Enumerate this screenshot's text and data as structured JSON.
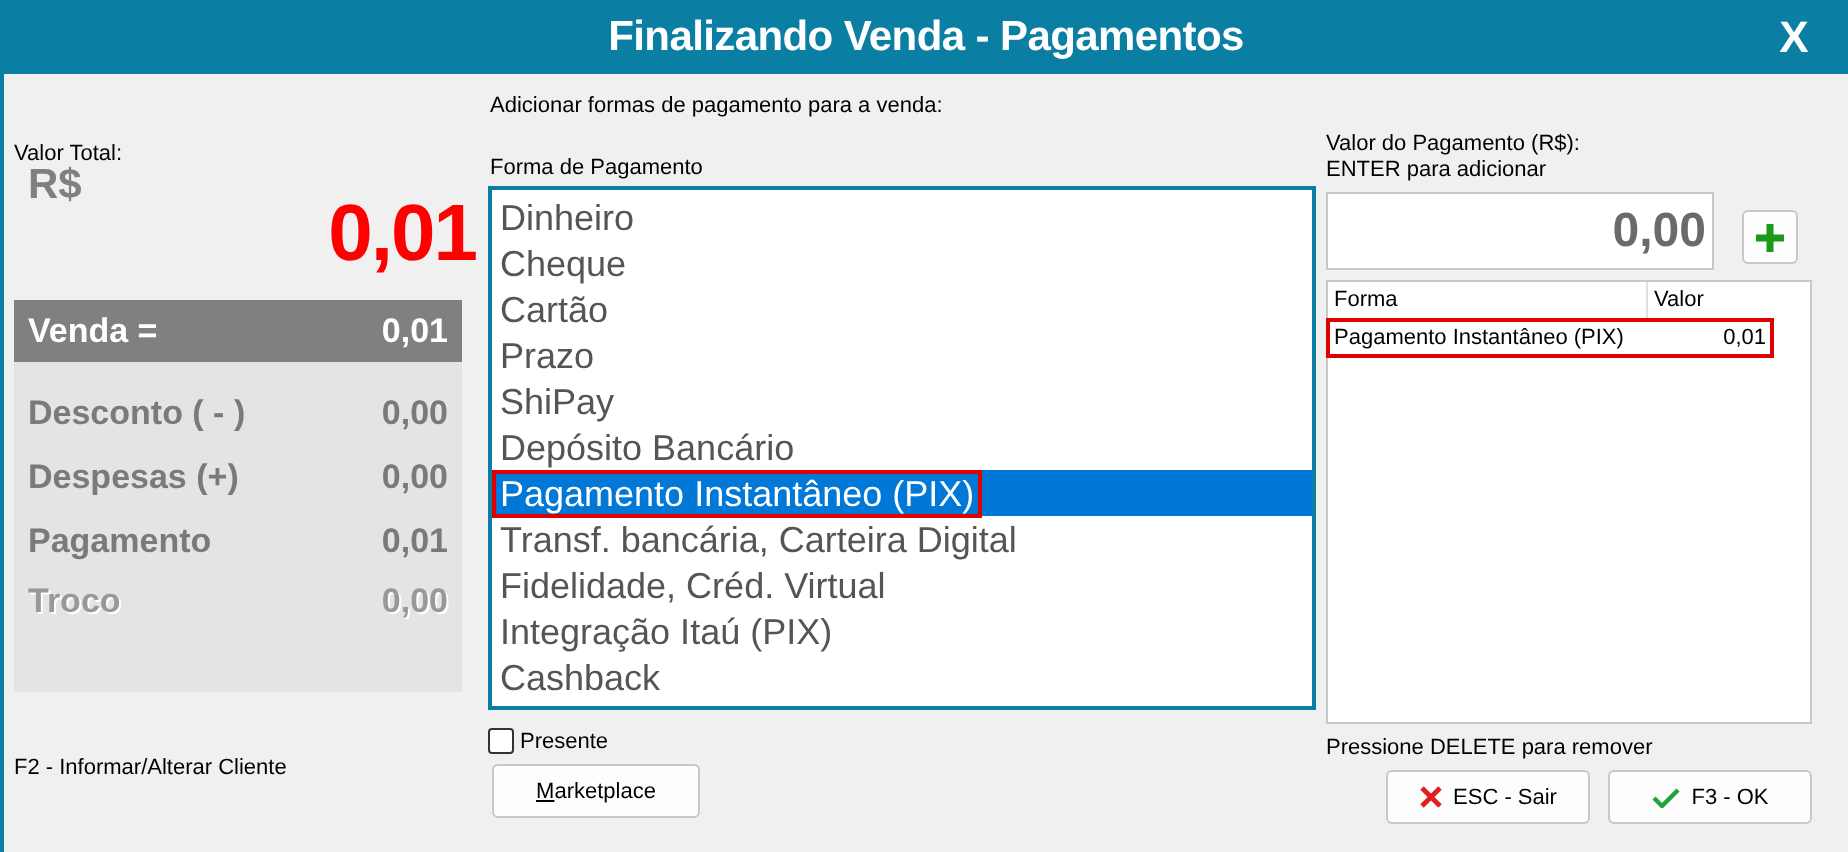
{
  "window": {
    "title": "Finalizando Venda - Pagamentos",
    "close": "X"
  },
  "summary": {
    "total_label": "Valor Total:",
    "currency": "R$",
    "total": "0,01",
    "header": {
      "label": "Venda =",
      "value": "0,01"
    },
    "rows": [
      {
        "label": "Desconto ( - )",
        "value": "0,00",
        "disabled": false
      },
      {
        "label": "Despesas (+)",
        "value": "0,00",
        "disabled": false
      },
      {
        "label": "Pagamento",
        "value": "0,01",
        "disabled": false
      },
      {
        "label": "Troco",
        "value": "0,00",
        "disabled": true
      }
    ]
  },
  "hint_client": "F2 - Informar/Alterar Cliente",
  "instructions": "Adicionar formas de pagamento para a venda:",
  "payment_list": {
    "label": "Forma de Pagamento",
    "items": [
      {
        "label": "Dinheiro",
        "selected": false,
        "highlighted": false
      },
      {
        "label": "Cheque",
        "selected": false,
        "highlighted": false
      },
      {
        "label": "Cartão",
        "selected": false,
        "highlighted": false
      },
      {
        "label": "Prazo",
        "selected": false,
        "highlighted": false
      },
      {
        "label": "ShiPay",
        "selected": false,
        "highlighted": false
      },
      {
        "label": "Depósito Bancário",
        "selected": false,
        "highlighted": false
      },
      {
        "label": "Pagamento Instantâneo (PIX)",
        "selected": true,
        "highlighted": true
      },
      {
        "label": "Transf. bancária, Carteira Digital",
        "selected": false,
        "highlighted": false
      },
      {
        "label": "Fidelidade, Créd. Virtual",
        "selected": false,
        "highlighted": false
      },
      {
        "label": "Integração Itaú (PIX)",
        "selected": false,
        "highlighted": false
      },
      {
        "label": "Cashback",
        "selected": false,
        "highlighted": false
      }
    ]
  },
  "gift": {
    "label": "Presente",
    "checked": false
  },
  "marketplace_button": "Marketplace",
  "amount": {
    "label": "Valor do Pagamento (R$):",
    "hint": "ENTER para adicionar",
    "value": "0,00"
  },
  "payments_table": {
    "columns": [
      "Forma",
      "Valor"
    ],
    "rows": [
      {
        "cells": [
          "Pagamento Instantâneo (PIX)",
          "0,01"
        ],
        "highlighted": true
      }
    ]
  },
  "delete_hint": "Pressione DELETE para remover",
  "buttons": [
    {
      "kind": "cancel",
      "label": "ESC - Sair"
    },
    {
      "kind": "ok",
      "label": "F3 - OK"
    }
  ]
}
